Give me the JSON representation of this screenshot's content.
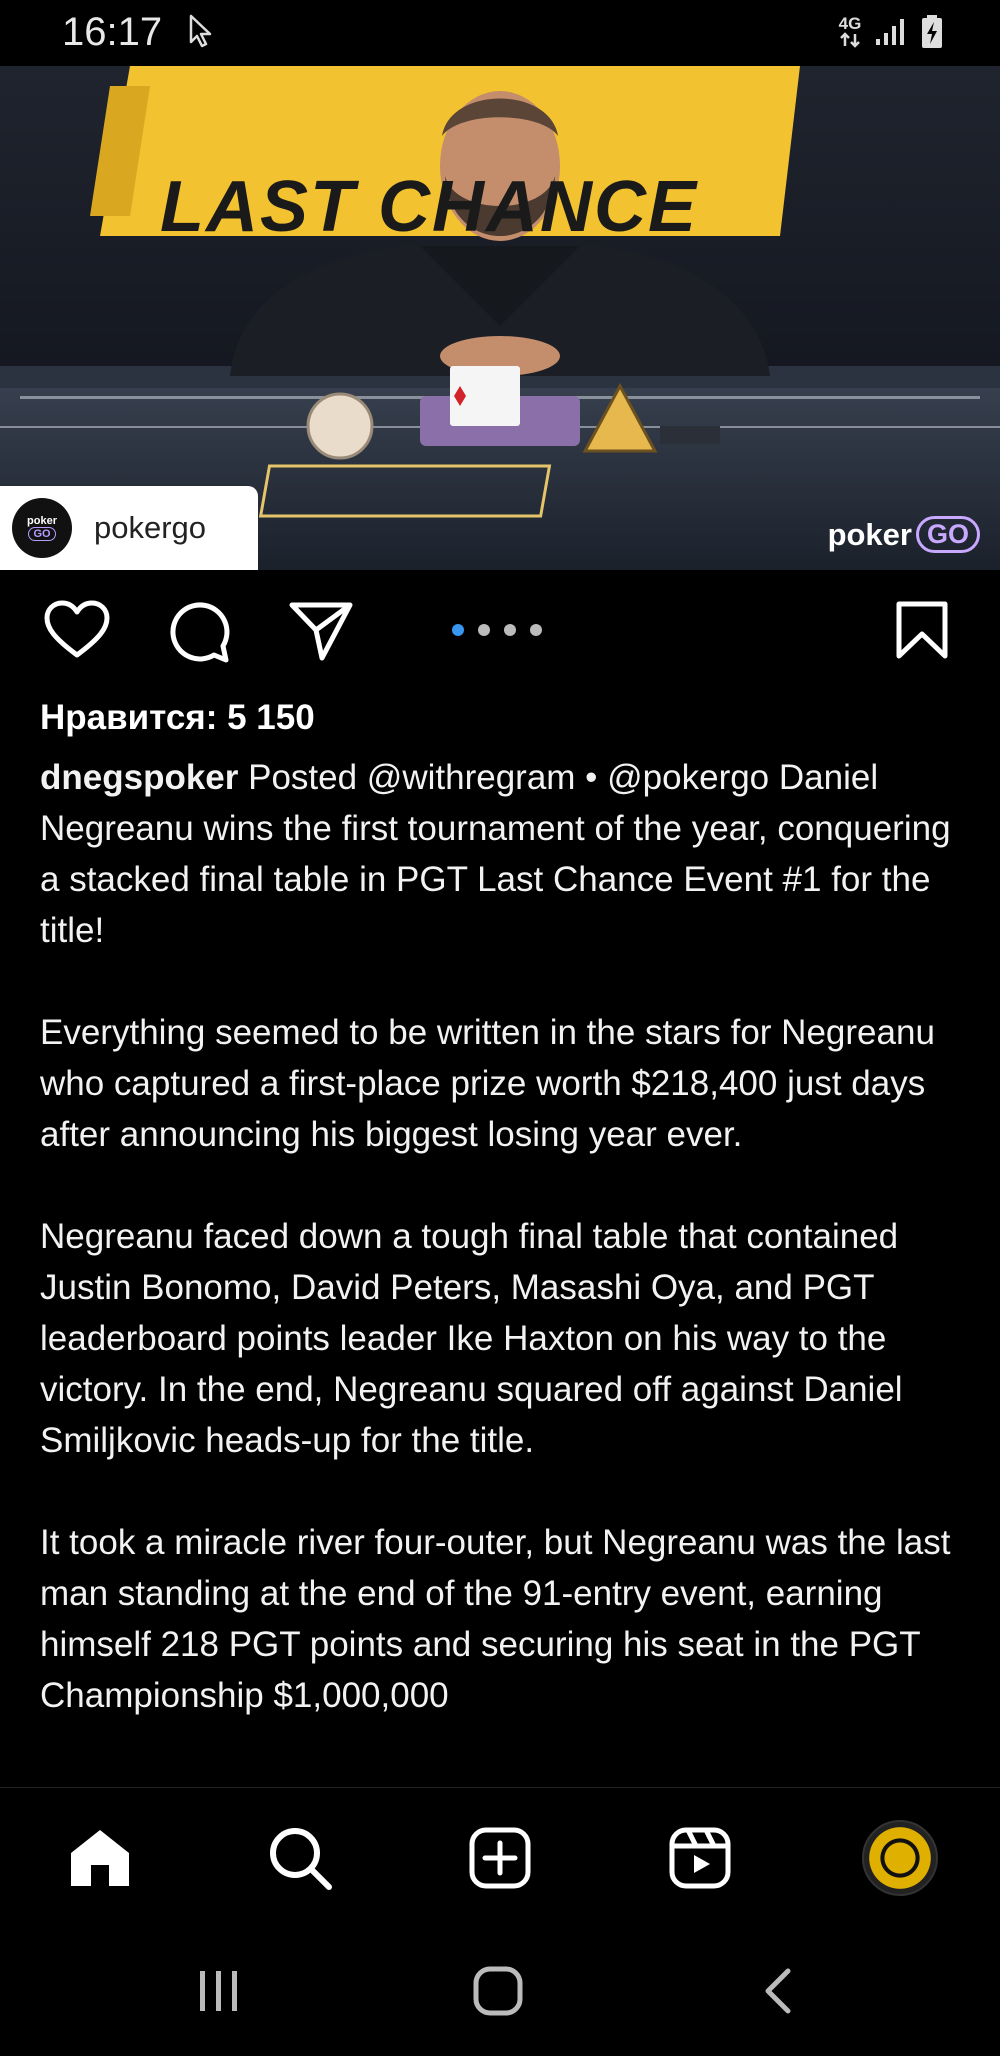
{
  "status_bar": {
    "time": "16:17",
    "network": "4G",
    "icons": [
      "cursor-icon",
      "data-arrows-icon",
      "signal-icon",
      "battery-charging-icon"
    ]
  },
  "post": {
    "image": {
      "banner_text": "LAST CHANCE",
      "account_chip": {
        "avatar_text_top": "poker",
        "avatar_text_bottom": "GO",
        "name": "pokergo"
      },
      "watermark": {
        "text": "poker",
        "badge": "GO"
      }
    },
    "actions": {
      "icons": [
        "heart-icon",
        "comment-icon",
        "share-icon",
        "bookmark-icon"
      ],
      "carousel_position": 1,
      "carousel_count": 4
    },
    "likes": "Нравится: 5 150",
    "caption": {
      "username": "dnegspoker",
      "first_paragraph_rest": " Posted @withregram • @pokergo Daniel Negreanu wins the first tournament of the year, conquering a stacked final table in PGT Last Chance Event #1 for the title!",
      "paragraphs": [
        "Everything seemed to be written in the stars for Negreanu who captured a first-place prize worth $218,400 just days after announcing his biggest losing year ever.",
        "Negreanu faced down a tough final table that contained Justin Bonomo, David Peters, Masashi Oya, and PGT leaderboard points leader Ike Haxton on his way to the victory. In the end, Negreanu squared off against Daniel Smiljkovic heads-up for the title.",
        "It took a miracle river four-outer, but Negreanu was the last man standing at the end of the 91-entry event, earning himself 218 PGT points and securing his seat in the PGT Championship $1,000,000"
      ]
    }
  },
  "bottom_nav": {
    "items": [
      "home-icon",
      "search-icon",
      "create-icon",
      "reels-icon",
      "profile-avatar"
    ]
  },
  "system_nav": {
    "items": [
      "recents-icon",
      "home-button-icon",
      "back-icon"
    ]
  },
  "colors": {
    "background": "#000000",
    "accent_blue": "#3897f0",
    "banner_yellow": "#f2c230"
  }
}
